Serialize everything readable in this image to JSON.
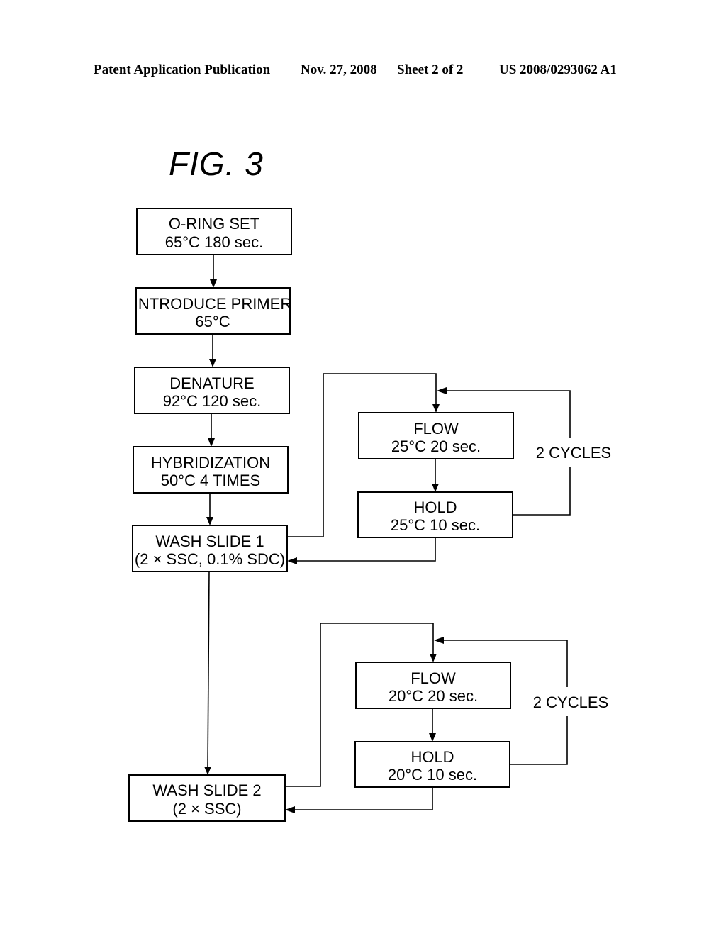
{
  "header": {
    "publication": "Patent Application Publication",
    "date": "Nov. 27, 2008",
    "sheet": "Sheet 2 of 2",
    "number": "US 2008/0293062 A1"
  },
  "figure": {
    "title": "FIG.  3"
  },
  "steps": {
    "oring": {
      "line1": "O-RING SET",
      "line2": "65°C  180 sec."
    },
    "primer": {
      "line1": "INTRODUCE PRIMER",
      "line2": "65°C"
    },
    "denature": {
      "line1": "DENATURE",
      "line2": "92°C  120 sec."
    },
    "hybridization": {
      "line1": "HYBRIDIZATION",
      "line2": "50°C   4 TIMES"
    },
    "wash1": {
      "line1": "WASH SLIDE 1",
      "line2": "(2 × SSC,  0.1% SDC)"
    },
    "flow1": {
      "line1": "FLOW",
      "line2": "25°C  20 sec."
    },
    "hold1": {
      "line1": "HOLD",
      "line2": "25°C  10 sec."
    },
    "cycles1": "2 CYCLES",
    "wash2": {
      "line1": "WASH SLIDE 2",
      "line2": "(2 × SSC)"
    },
    "flow2": {
      "line1": "FLOW",
      "line2": "20°C  20 sec."
    },
    "hold2": {
      "line1": "HOLD",
      "line2": "20°C  10 sec."
    },
    "cycles2": "2 CYCLES"
  }
}
